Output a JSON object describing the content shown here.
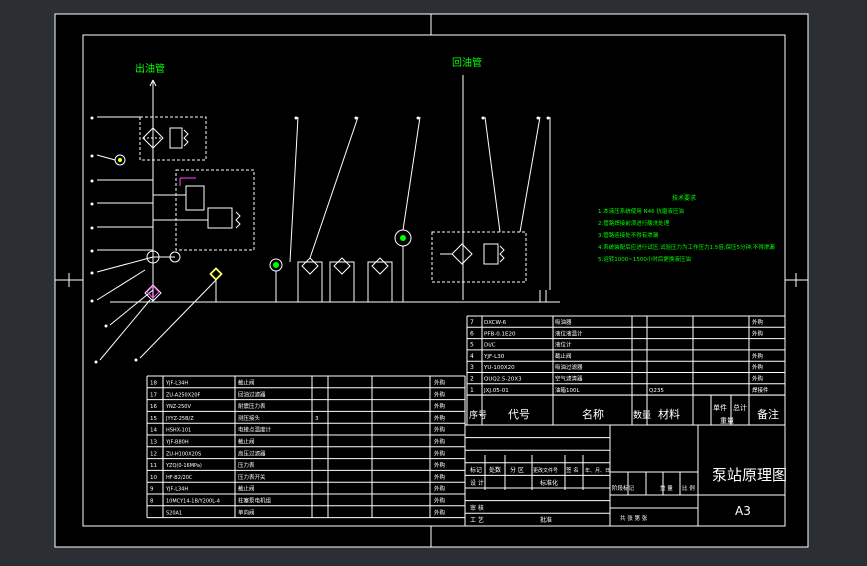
{
  "drawing": {
    "title": "泵站原理图",
    "size": "A3",
    "label_out_pipe": "出油管",
    "label_return_pipe": "回油管"
  },
  "colors": {
    "background": "#2b2f33",
    "paper": "#000000",
    "lines": "#ffffff",
    "notes": "#00ff00",
    "symbols": "#ff40ff",
    "accent": "#ffff00"
  },
  "notes": {
    "title": "技术要求",
    "lines": [
      "1.本液压系统使用 N46 抗磨液压油",
      "2.管路焊接前须进行酸洗处理",
      "3.管路连接处不得有渗漏",
      "4.系统装配后应进行试压,试验压力为工作压力1.5倍,保压5分钟,不得渗漏",
      "5.运转1000~1500小时后更换液压油"
    ]
  },
  "upper_table": [
    {
      "no": "7",
      "code": "DXCW-6",
      "name": "吸油器",
      "remark": "外购"
    },
    {
      "no": "6",
      "code": "PFB-0.1E20",
      "name": "液位液温计",
      "remark": "外购"
    },
    {
      "no": "5",
      "code": "DI/C",
      "name": "液位计",
      "remark": ""
    },
    {
      "no": "4",
      "code": "YJF-L30",
      "name": "截止阀",
      "remark": "外购"
    },
    {
      "no": "3",
      "code": "YU-100X20",
      "name": "吸油过滤器",
      "remark": "外购"
    },
    {
      "no": "2",
      "code": "QUQ2.5-20X3",
      "name": "空气滤清器",
      "remark": "外购"
    },
    {
      "no": "1",
      "code": "JXJ.05-01",
      "name": "油箱100L",
      "material": "Q235",
      "remark": "焊接件"
    }
  ],
  "lower_table": [
    {
      "no": "18",
      "code": "YJF-L34H",
      "name": "截止阀",
      "remark": "外购"
    },
    {
      "no": "17",
      "code": "ZU-A250X20F",
      "name": "回油过滤器",
      "remark": "外购"
    },
    {
      "no": "16",
      "code": "YNZ-250V",
      "name": "耐震压力表",
      "remark": "外购"
    },
    {
      "no": "15",
      "code": "JYYZ-25B/Z",
      "name": "测压接头",
      "qty": "3",
      "remark": "外购"
    },
    {
      "no": "14",
      "code": "HSHX-101",
      "name": "电接点温度计",
      "remark": "外购"
    },
    {
      "no": "13",
      "code": "YJF-B80H",
      "name": "截止阀",
      "remark": "外购"
    },
    {
      "no": "12",
      "code": "ZU-H100X20S",
      "name": "高压过滤器",
      "remark": "外购"
    },
    {
      "no": "11",
      "code": "YZQ(0-16MPa)",
      "name": "压力表",
      "remark": "外购"
    },
    {
      "no": "10",
      "code": "HF-B2/20C",
      "name": "压力表开关",
      "remark": "外购"
    },
    {
      "no": "9",
      "code": "YJF-L34H",
      "name": "截止阀",
      "remark": "外购"
    },
    {
      "no": "8",
      "code": "10MCY14-1B/Y200L-4",
      "name": "柱塞泵电机组",
      "remark": "外购"
    },
    {
      "no": "",
      "code": "S20A1",
      "name": "单向阀",
      "remark": "外购"
    }
  ],
  "header_row": {
    "seq": "序号",
    "code": "代号",
    "name": "名称",
    "qty": "数量",
    "material": "材料",
    "unit_weight": "单件",
    "total_weight": "总计",
    "weight": "重量",
    "remark": "备注"
  },
  "title_block": {
    "mark": "标记",
    "count": "处数",
    "zone": "分 区",
    "change_doc": "更改文件号",
    "sign": "签 名",
    "date": "年、月、日",
    "design": "设 计",
    "standardize": "标准化",
    "review": "审 核",
    "craft": "工 艺",
    "approve": "批准",
    "stage_mark": "阶段标记",
    "weight": "重 量",
    "scale": "比 例",
    "sheets": "共 张 第 张"
  }
}
